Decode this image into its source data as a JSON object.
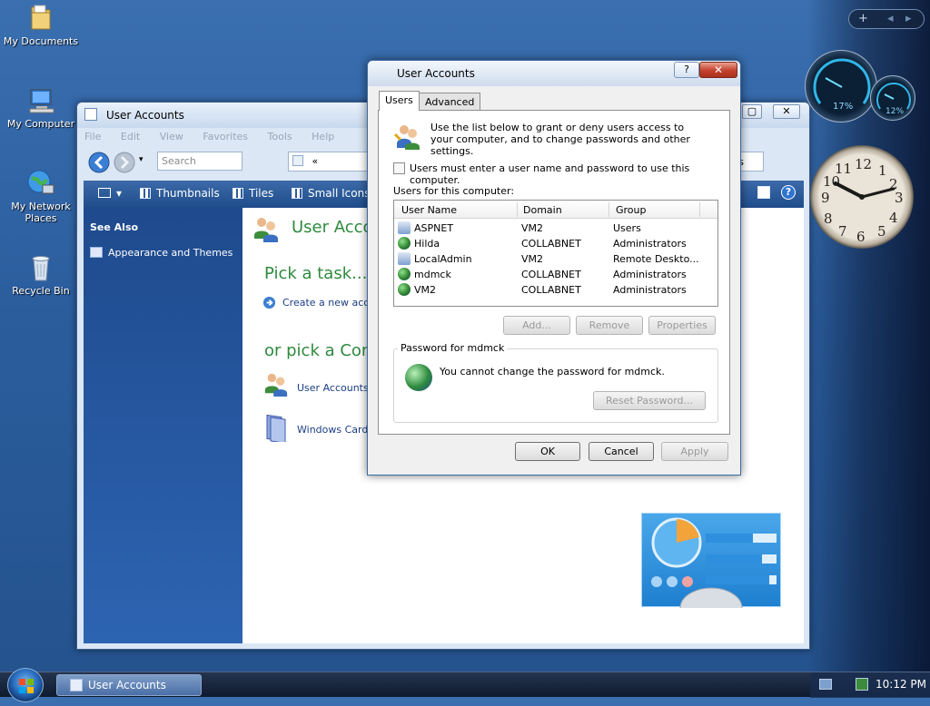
{
  "desktop": {
    "icons": [
      {
        "label": "My Documents"
      },
      {
        "label": "My Computer"
      },
      {
        "label": "My Network Places"
      },
      {
        "label": "Recycle Bin"
      }
    ]
  },
  "explorer": {
    "title": "User Accounts",
    "menu": [
      "File",
      "Edit",
      "View",
      "Favorites",
      "Tools",
      "Help"
    ],
    "search_placeholder": "Search",
    "address_value": "«",
    "address_tail": "nts",
    "toolbar": {
      "thumbnails": "Thumbnails",
      "tiles": "Tiles",
      "small_icons": "Small Icons"
    },
    "sidebar": {
      "heading": "See Also",
      "link": "Appearance and Themes"
    },
    "main": {
      "title": "User Accou",
      "pick_task": "Pick a task...",
      "create_account": "Create a new accou",
      "pick_control": "or pick a Contr",
      "user_accounts_link": "User Accounts",
      "cardspace_link": "Windows CardS"
    }
  },
  "dialog": {
    "title": "User Accounts",
    "help": "?",
    "close": "✕",
    "tabs": [
      "Users",
      "Advanced"
    ],
    "intro": "Use the list below to grant or deny users access to your computer, and to change passwords and other settings.",
    "checkbox_label": "Users must enter a user name and password to use this computer.",
    "checkbox_checked": false,
    "list_label": "Users for this computer:",
    "columns": [
      "User Name",
      "Domain",
      "Group"
    ],
    "users": [
      {
        "name": "ASPNET",
        "domain": "VM2",
        "group": "Users",
        "icon": "computer-user-icon"
      },
      {
        "name": "Hilda",
        "domain": "COLLABNET",
        "group": "Administrators",
        "icon": "globe-user-icon"
      },
      {
        "name": "LocalAdmin",
        "domain": "VM2",
        "group": "Remote Deskto...",
        "icon": "computer-user-icon"
      },
      {
        "name": "mdmck",
        "domain": "COLLABNET",
        "group": "Administrators",
        "icon": "globe-user-icon"
      },
      {
        "name": "VM2",
        "domain": "COLLABNET",
        "group": "Administrators",
        "icon": "globe-user-icon"
      }
    ],
    "buttons": {
      "add": "Add...",
      "remove": "Remove",
      "properties": "Properties"
    },
    "password_group": {
      "legend": "Password for mdmck",
      "message": "You cannot change the password for mdmck.",
      "reset": "Reset Password..."
    },
    "footer": {
      "ok": "OK",
      "cancel": "Cancel",
      "apply": "Apply"
    }
  },
  "gadgets": {
    "toolbar_add": "+",
    "toolbar_prev": "◂",
    "toolbar_next": "▸",
    "cpu_percent": "17%",
    "mem_percent": "12%",
    "clock_numbers": [
      "12",
      "1",
      "2",
      "3",
      "4",
      "5",
      "6",
      "7",
      "8",
      "9",
      "10",
      "11"
    ]
  },
  "taskbar": {
    "task_button": "User Accounts",
    "time": "10:12 PM"
  },
  "colors": {
    "accent_green": "#2e8a3e",
    "link_blue": "#1c3f84",
    "close_red": "#c3412c"
  }
}
